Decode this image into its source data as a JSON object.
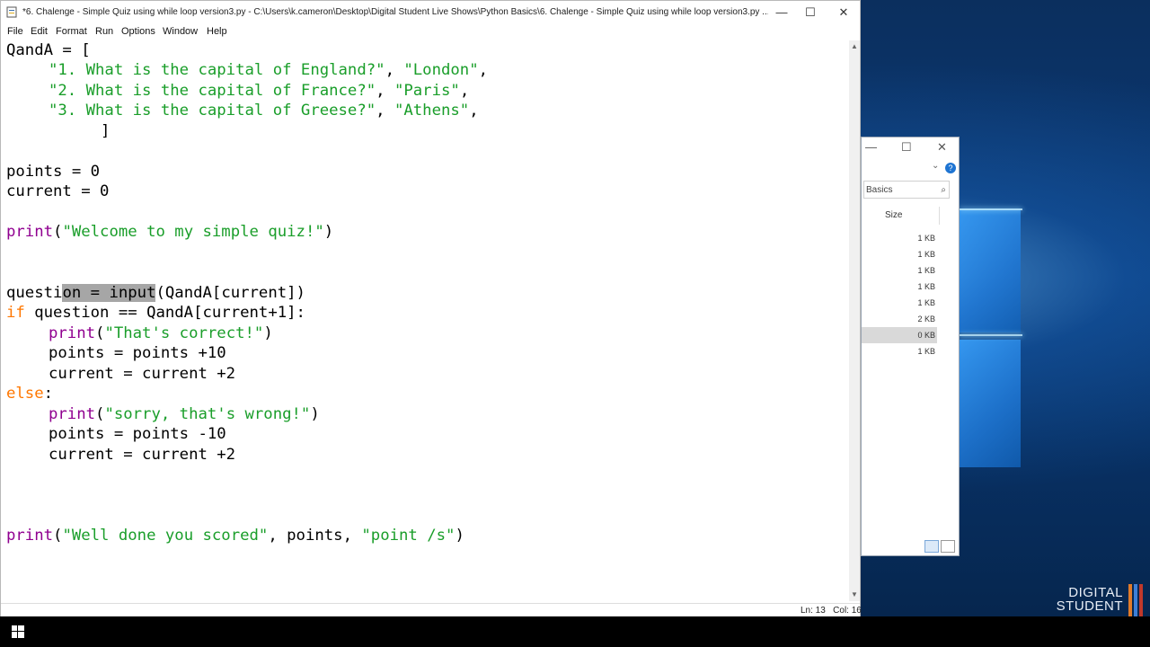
{
  "editor": {
    "window_title": "*6. Chalenge - Simple Quiz using while loop version3.py - C:\\Users\\k.cameron\\Desktop\\Digital Student Live Shows\\Python Basics\\6. Chalenge - Simple Quiz using while loop version3.py ...",
    "controls": {
      "minimize": "—",
      "maximize": "☐",
      "close": "✕"
    },
    "menu": [
      "File",
      "Edit",
      "Format",
      "Run",
      "Options",
      "Window",
      "Help"
    ],
    "code": {
      "l1": "QandA = [",
      "l2a": "\"1. What is the capital of England?\"",
      "l2b": ", ",
      "l2c": "\"London\"",
      "l2d": ",",
      "l3a": "\"2. What is the capital of France?\"",
      "l3b": ", ",
      "l3c": "\"Paris\"",
      "l3d": ",",
      "l4a": "\"3. What is the capital of Greese?\"",
      "l4b": ", ",
      "l4c": "\"Athens\"",
      "l4d": ",",
      "l5": "]",
      "l7": "points = 0",
      "l8": "current = 0",
      "l10a": "print",
      "l10b": "(",
      "l10c": "\"Welcome to my simple quiz!\"",
      "l10d": ")",
      "l13a": "questi",
      "l13b": "on = input",
      "l13c": "(QandA[current])",
      "l14a": "if",
      "l14b": " question == QandA[current+1]:",
      "l15a": "print",
      "l15b": "(",
      "l15c": "\"That's correct!\"",
      "l15d": ")",
      "l16": "points = points +10",
      "l17": "current = current +2",
      "l18a": "else",
      "l18b": ":",
      "l19a": "print",
      "l19b": "(",
      "l19c": "\"sorry, that's wrong!\"",
      "l19d": ")",
      "l20": "points = points -10",
      "l21": "current = current +2",
      "l25a": "print",
      "l25b": "(",
      "l25c": "\"Well done you scored\"",
      "l25d": ", points, ",
      "l25e": "\"point /s\"",
      "l25f": ")"
    },
    "status": {
      "line": "Ln: 13",
      "col": "Col: 16"
    }
  },
  "explorer": {
    "search_placeholder": "Basics",
    "column_header": "Size",
    "sizes": [
      "1 KB",
      "1 KB",
      "1 KB",
      "1 KB",
      "1 KB",
      "2 KB",
      "0 KB",
      "1 KB"
    ],
    "selected_index": 6
  },
  "brand": {
    "line1": "DIGITAL",
    "line2": "STUDENT",
    "colors": [
      "#e07b2a",
      "#3d7fd6",
      "#c0392b"
    ]
  },
  "colors": {
    "string": "#1a9e2a",
    "keyword": "#ff7700",
    "builtin": "#900090",
    "selection": "#a6a6a6"
  }
}
